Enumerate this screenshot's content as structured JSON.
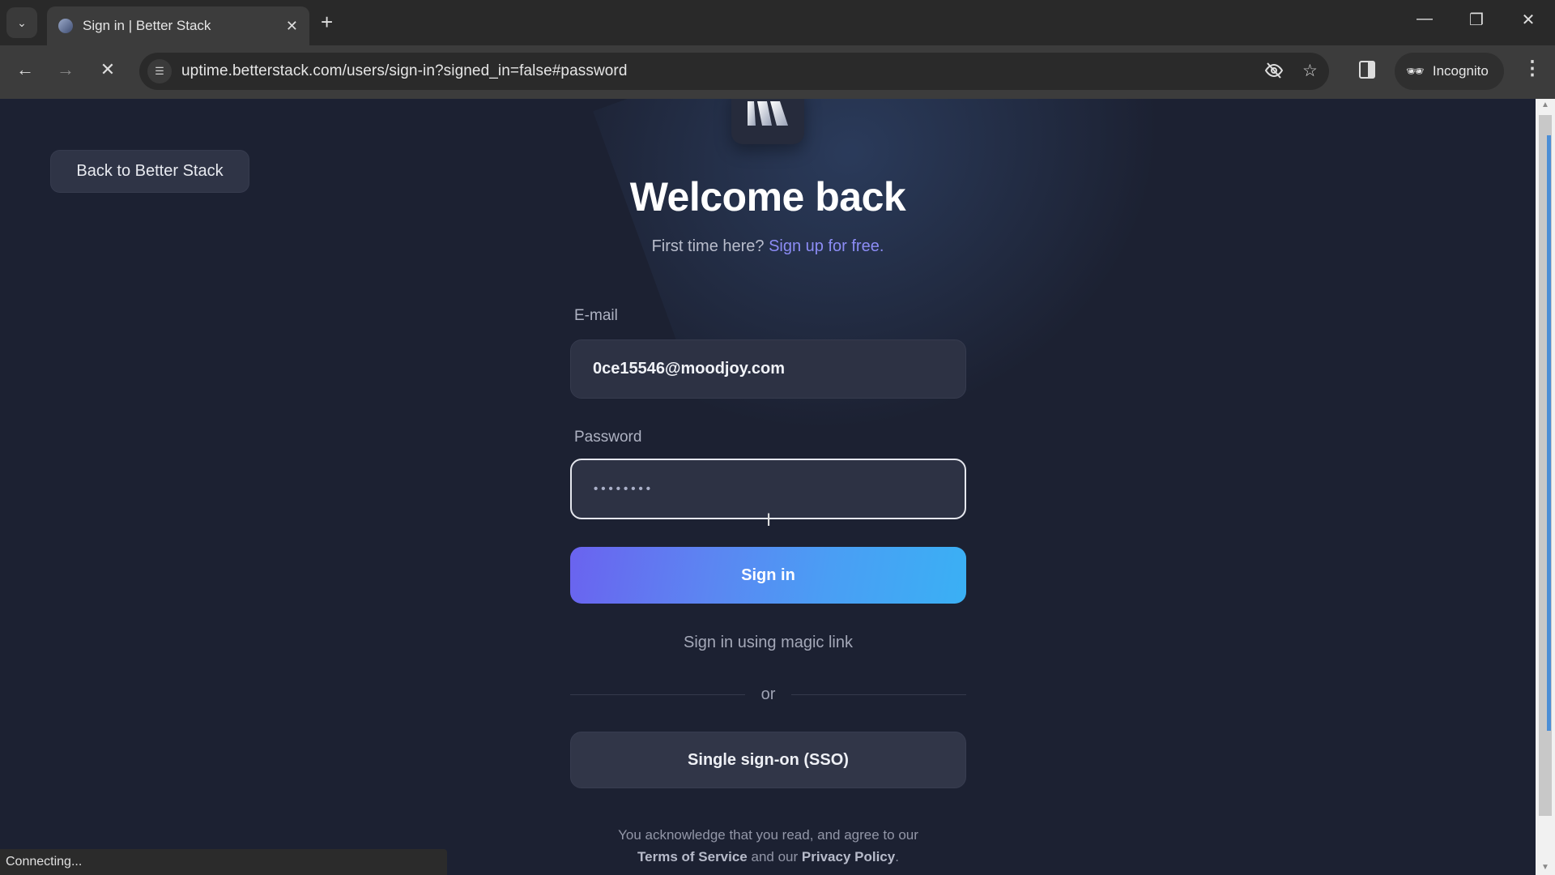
{
  "browser": {
    "tab_title": "Sign in | Better Stack",
    "url": "uptime.betterstack.com/users/sign-in?signed_in=false#password",
    "incognito_label": "Incognito",
    "status_text": "Connecting...",
    "icons": {
      "tab_search": "chevron-down-icon",
      "tab_close": "close-icon",
      "new_tab": "plus-icon",
      "back": "arrow-left-icon",
      "forward": "arrow-right-icon",
      "stop": "close-icon",
      "site_info": "tune-icon",
      "tracking": "eye-off-icon",
      "bookmark": "star-icon",
      "side_panel": "side-panel-icon",
      "incognito": "incognito-icon",
      "menu": "more-vertical-icon"
    }
  },
  "page": {
    "back_button_label": "Back to Better Stack",
    "heading": "Welcome back",
    "subtext_prefix": "First time here?",
    "signup_link": "Sign up for free.",
    "email": {
      "label": "E-mail",
      "value": "0ce15546@moodjoy.com"
    },
    "password": {
      "label": "Password",
      "masked_value": "••••••••"
    },
    "signin_button_label": "Sign in",
    "magic_link_label": "Sign in using magic link",
    "divider_text": "or",
    "sso_button_label": "Single sign-on (SSO)",
    "legal": {
      "line1": "You acknowledge that you read, and agree to our",
      "terms_link": "Terms of Service",
      "and_text": "and our",
      "privacy_link": "Privacy Policy",
      "end": "."
    },
    "colors": {
      "background": "#1c2132",
      "accent_link": "#8c8cf5",
      "button_gradient_start": "#6a63ef",
      "button_gradient_end": "#3ab0f4"
    }
  }
}
